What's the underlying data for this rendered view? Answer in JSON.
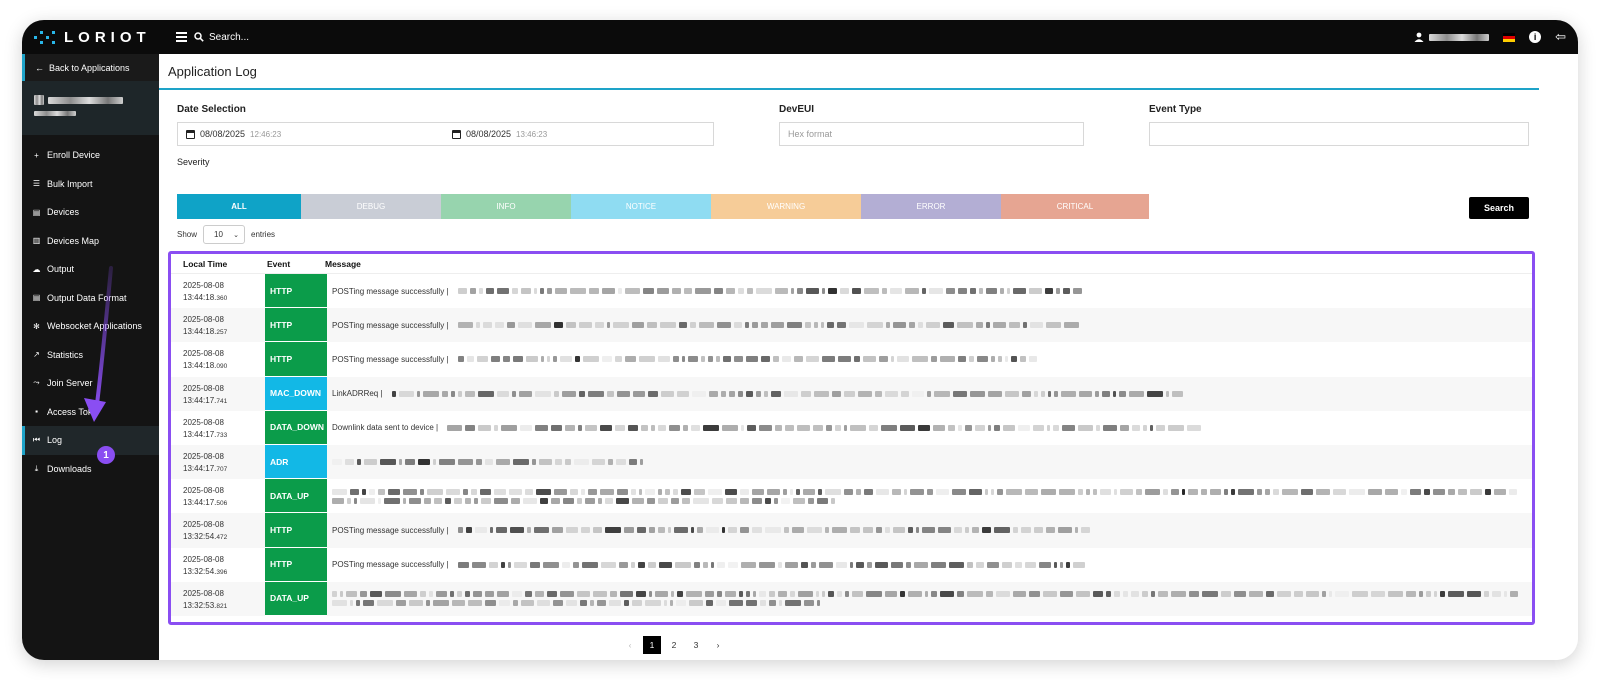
{
  "topbar": {
    "brand": "LORIOT",
    "search_placeholder": "Search..."
  },
  "sidebar": {
    "back_label": "Back to Applications",
    "items": [
      {
        "label": "Enroll Device",
        "icon": "plus-icon",
        "glyph": "+"
      },
      {
        "label": "Bulk Import",
        "icon": "list-icon",
        "glyph": "☰"
      },
      {
        "label": "Devices",
        "icon": "devices-icon",
        "glyph": "▤"
      },
      {
        "label": "Devices Map",
        "icon": "map-icon",
        "glyph": "▥"
      },
      {
        "label": "Output",
        "icon": "cloud-icon",
        "glyph": "☁"
      },
      {
        "label": "Output Data Format",
        "icon": "format-icon",
        "glyph": "▤"
      },
      {
        "label": "Websocket Applications",
        "icon": "gear-icon",
        "glyph": "✻"
      },
      {
        "label": "Statistics",
        "icon": "chart-icon",
        "glyph": "↗"
      },
      {
        "label": "Join Server",
        "icon": "join-icon",
        "glyph": "⤳"
      },
      {
        "label": "Access Tok",
        "icon": "lock-icon",
        "glyph": "▪"
      },
      {
        "label": "Log",
        "icon": "log-icon",
        "glyph": "⏮"
      },
      {
        "label": "Downloads",
        "icon": "download-icon",
        "glyph": "⤓"
      }
    ]
  },
  "main": {
    "title": "Application Log",
    "date_label": "Date Selection",
    "date_from": "08/08/2025",
    "date_from_time": "12:46:23",
    "date_to": "08/08/2025",
    "date_to_time": "13:46:23",
    "deveui_label": "DevEUI",
    "deveui_placeholder": "Hex format",
    "event_label": "Event Type",
    "severity_label": "Severity",
    "severity": [
      {
        "label": "ALL",
        "color": "#0fa3c7",
        "bold": true
      },
      {
        "label": "DEBUG",
        "color": "#c9cdd6"
      },
      {
        "label": "INFO",
        "color": "#97d4ae"
      },
      {
        "label": "NOTICE",
        "color": "#8fdcf2"
      },
      {
        "label": "WARNING",
        "color": "#f6cc98"
      },
      {
        "label": "ERROR",
        "color": "#b3aed4"
      },
      {
        "label": "CRITICAL",
        "color": "#e6a592"
      }
    ],
    "search_label": "Search",
    "show_label": "Show",
    "entries_value": "10",
    "entries_label": "entries"
  },
  "table": {
    "headers": [
      "Local Time",
      "Event",
      "Message"
    ],
    "rows": [
      {
        "date": "2025-08-08",
        "time": "13:44:18.",
        "ms": "360",
        "event": "HTTP",
        "color": "#0b9c4a",
        "prefix": "POSTing message successfully |"
      },
      {
        "date": "2025-08-08",
        "time": "13:44:18.",
        "ms": "257",
        "event": "HTTP",
        "color": "#0b9c4a",
        "prefix": "POSTing message successfully |"
      },
      {
        "date": "2025-08-08",
        "time": "13:44:18.",
        "ms": "090",
        "event": "HTTP",
        "color": "#0b9c4a",
        "prefix": "POSTing message successfully |"
      },
      {
        "date": "2025-08-08",
        "time": "13:44:17.",
        "ms": "741",
        "event": "MAC_DOWN",
        "color": "#12b8e6",
        "prefix": "LinkADRReq |"
      },
      {
        "date": "2025-08-08",
        "time": "13:44:17.",
        "ms": "733",
        "event": "DATA_DOWN",
        "color": "#0b9c4a",
        "prefix": "Downlink data sent to device |"
      },
      {
        "date": "2025-08-08",
        "time": "13:44:17.",
        "ms": "707",
        "event": "ADR",
        "color": "#12b8e6",
        "prefix": ""
      },
      {
        "date": "2025-08-08",
        "time": "13:44:17.",
        "ms": "506",
        "event": "DATA_UP",
        "color": "#0b9c4a",
        "prefix": ""
      },
      {
        "date": "2025-08-08",
        "time": "13:32:54.",
        "ms": "472",
        "event": "HTTP",
        "color": "#0b9c4a",
        "prefix": "POSTing message successfully |"
      },
      {
        "date": "2025-08-08",
        "time": "13:32:54.",
        "ms": "396",
        "event": "HTTP",
        "color": "#0b9c4a",
        "prefix": "POSTing message successfully |"
      },
      {
        "date": "2025-08-08",
        "time": "13:32:53.",
        "ms": "821",
        "event": "DATA_UP",
        "color": "#0b9c4a",
        "prefix": ""
      }
    ]
  },
  "pagination": {
    "prev": "‹",
    "pages": [
      "1",
      "2",
      "3"
    ],
    "next": "›",
    "current": "1"
  },
  "annotation": {
    "badge": "1",
    "color": "#8a4ef2"
  }
}
